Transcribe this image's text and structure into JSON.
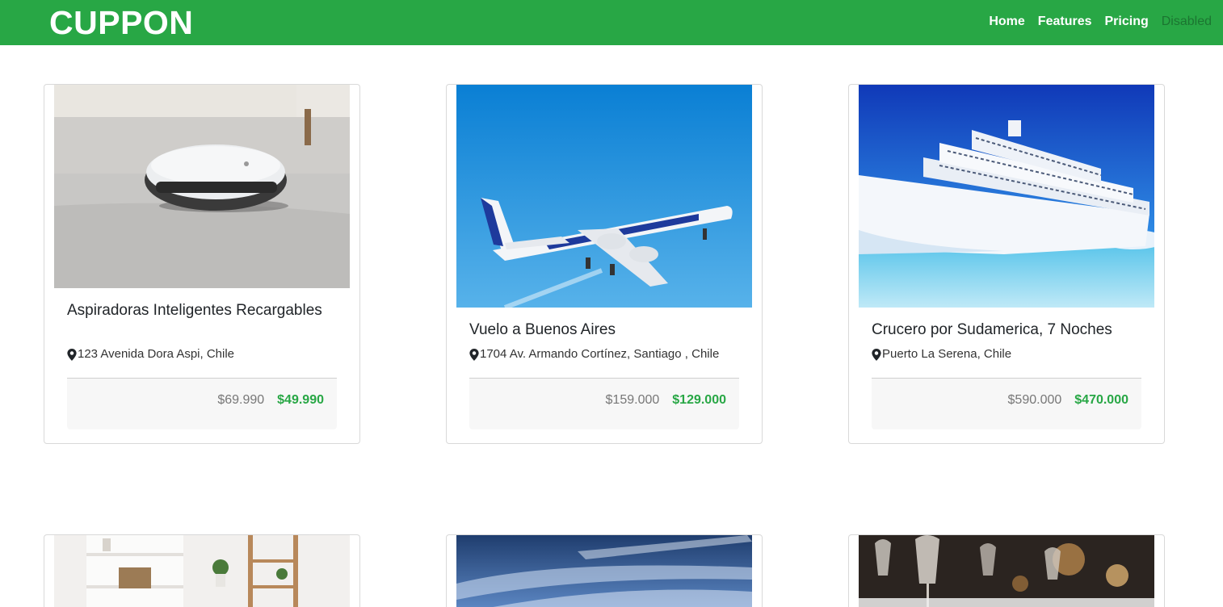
{
  "navbar": {
    "brand": "CUPPON",
    "links": [
      {
        "label": "Home"
      },
      {
        "label": "Features"
      },
      {
        "label": "Pricing"
      },
      {
        "label": "Disabled"
      }
    ]
  },
  "cards": [
    {
      "title": "Aspiradoras Inteligentes Recargables",
      "location": "123 Avenida Dora Aspi, Chile",
      "old_price": "$69.990",
      "new_price": "$49.990",
      "image": "robot-vacuum"
    },
    {
      "title": "Vuelo a Buenos Aires",
      "location": "1704 Av. Armando Cortínez, Santiago , Chile",
      "old_price": "$159.000",
      "new_price": "$129.000",
      "image": "airplane"
    },
    {
      "title": "Crucero por Sudamerica, 7 Noches",
      "location": "Puerto La Serena, Chile",
      "old_price": "$590.000",
      "new_price": "$470.000",
      "image": "cruise-ship"
    },
    {
      "image": "shelves-interior"
    },
    {
      "image": "sky"
    },
    {
      "image": "restaurant-glasses"
    }
  ],
  "colors": {
    "brand_green": "#28a745",
    "price_green": "#28a745",
    "old_price_gray": "#777777"
  }
}
